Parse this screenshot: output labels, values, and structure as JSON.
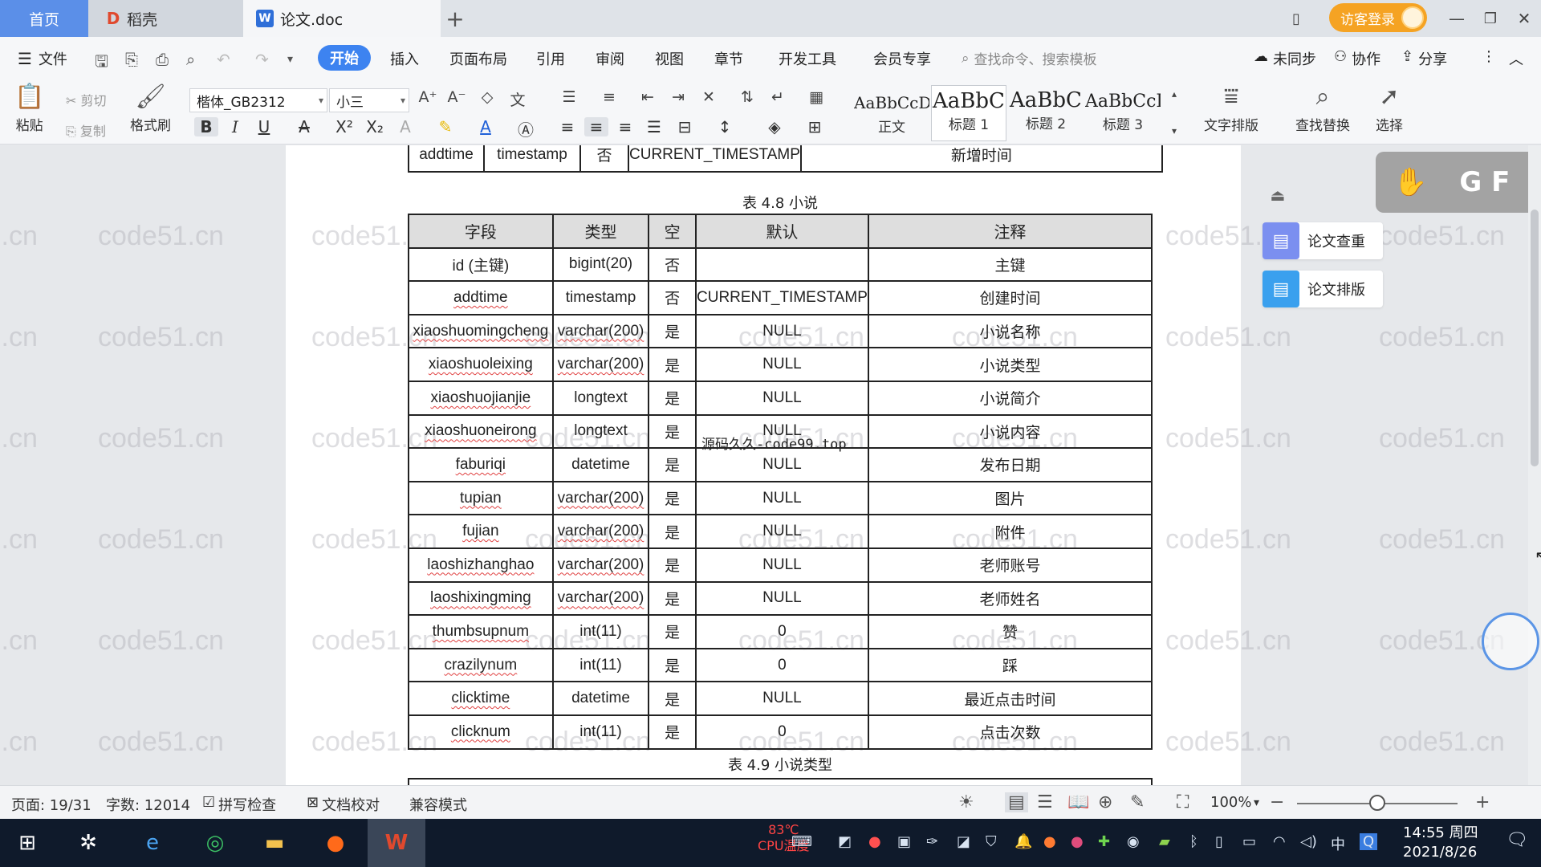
{
  "tabs": {
    "home": "首页",
    "docer": "稻壳",
    "document": "论文.doc",
    "new": "+"
  },
  "window": {
    "visitor_login": "访客登录"
  },
  "menu": {
    "file": "文件",
    "items": [
      "开始",
      "插入",
      "页面布局",
      "引用",
      "审阅",
      "视图",
      "章节",
      "开发工具",
      "会员专享"
    ],
    "search_placeholder": "查找命令、搜索模板",
    "not_synced": "未同步",
    "collaborate": "协作",
    "share": "分享"
  },
  "ribbon": {
    "paste": "粘贴",
    "cut": "剪切",
    "copy": "复制",
    "format_painter": "格式刷",
    "font_name": "楷体_GB2312",
    "font_size": "小三",
    "styles": [
      {
        "sample": "AaBbCcDd",
        "name": "正文"
      },
      {
        "sample": "AaBbC",
        "name": "标题 1"
      },
      {
        "sample": "AaBbC",
        "name": "标题 2"
      },
      {
        "sample": "AaBbCcI",
        "name": "标题 3"
      }
    ],
    "text_layout": "文字排版",
    "find_replace": "查找替换",
    "select": "选择"
  },
  "watermark_text": "code51.cn",
  "overlay_text": "源码久久-code99.top",
  "document": {
    "prev_row": [
      "addtime",
      "timestamp",
      "否",
      "CURRENT_TIMESTAMP",
      "新增时间"
    ],
    "table_caption": "表 4.8  小说",
    "headers": [
      "字段",
      "类型",
      "空",
      "默认",
      "注释"
    ],
    "rows": [
      [
        "id (主键)",
        "bigint(20)",
        "否",
        "",
        "主键"
      ],
      [
        "addtime",
        "timestamp",
        "否",
        "CURRENT_TIMESTAMP",
        "创建时间"
      ],
      [
        "xiaoshuomingcheng",
        "varchar(200)",
        "是",
        "NULL",
        "小说名称"
      ],
      [
        "xiaoshuoleixing",
        "varchar(200)",
        "是",
        "NULL",
        "小说类型"
      ],
      [
        "xiaoshuojianjie",
        "longtext",
        "是",
        "NULL",
        "小说简介"
      ],
      [
        "xiaoshuoneirong",
        "longtext",
        "是",
        "NULL",
        "小说内容"
      ],
      [
        "faburiqi",
        "datetime",
        "是",
        "NULL",
        "发布日期"
      ],
      [
        "tupian",
        "varchar(200)",
        "是",
        "NULL",
        "图片"
      ],
      [
        "fujian",
        "varchar(200)",
        "是",
        "NULL",
        "附件"
      ],
      [
        "laoshizhanghao",
        "varchar(200)",
        "是",
        "NULL",
        "老师账号"
      ],
      [
        "laoshixingming",
        "varchar(200)",
        "是",
        "NULL",
        "老师姓名"
      ],
      [
        "thumbsupnum",
        "int(11)",
        "是",
        "0",
        "赞"
      ],
      [
        "crazilynum",
        "int(11)",
        "是",
        "0",
        "踩"
      ],
      [
        "clicktime",
        "datetime",
        "是",
        "NULL",
        "最近点击时间"
      ],
      [
        "clicknum",
        "int(11)",
        "是",
        "0",
        "点击次数"
      ]
    ],
    "next_caption": "表 4.9  小说类型"
  },
  "side_panel": {
    "check": "论文查重",
    "layout": "论文排版",
    "gesture_letters": "G  F"
  },
  "status": {
    "page": "页面: 19/31",
    "words": "字数: 12014",
    "spell_check": "拼写检查",
    "doc_proof": "文档校对",
    "compat_mode": "兼容模式",
    "zoom": "100%"
  },
  "taskbar": {
    "cpu_temp": "83℃",
    "cpu_label": "CPU温度",
    "time": "14:55 周四",
    "date": "2021/8/26"
  },
  "colors": {
    "accent": "#3d83f0",
    "home_tab": "#5b8fe8",
    "login_orange": "#f5a323",
    "taskbar": "#0f1a2b"
  }
}
